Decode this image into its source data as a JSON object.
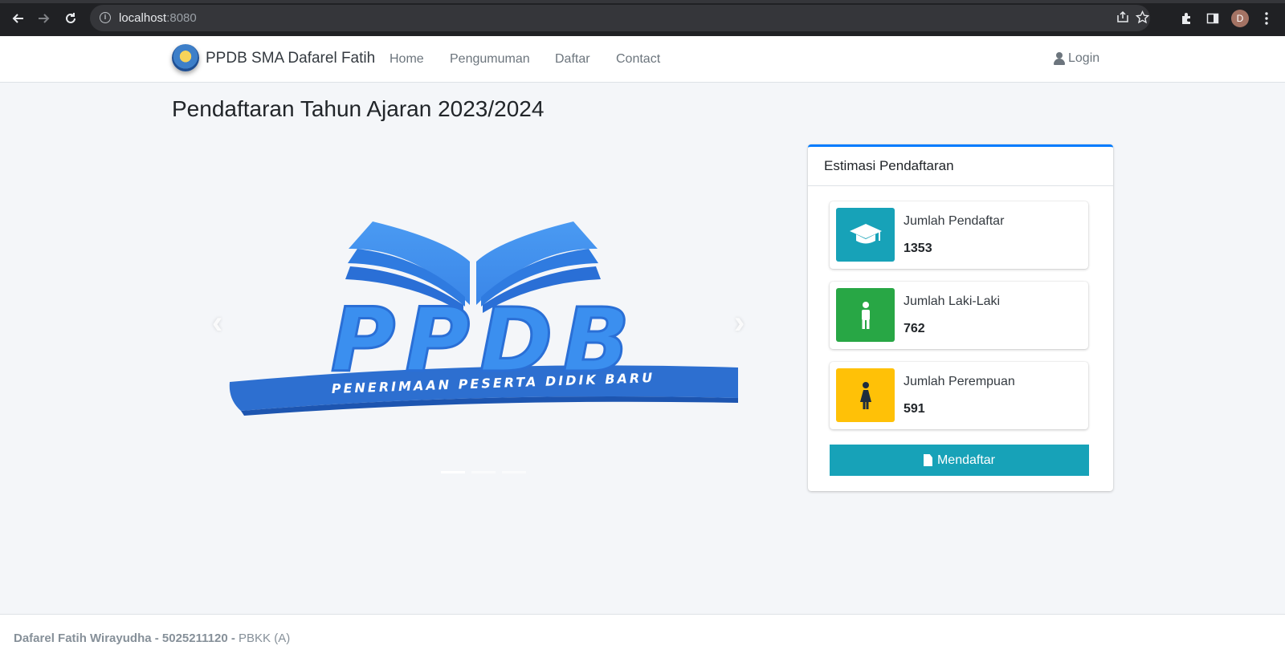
{
  "browser": {
    "url_host": "localhost",
    "url_port": ":8080",
    "profile_initial": "D"
  },
  "navbar": {
    "brand": "PPDB SMA Dafarel Fatih",
    "links": [
      "Home",
      "Pengumuman",
      "Daftar",
      "Contact"
    ],
    "login_label": "Login"
  },
  "page": {
    "title": "Pendaftaran Tahun Ajaran 2023/2024"
  },
  "carousel": {
    "logo_main": "PPDB",
    "logo_sub": "PENERIMAAN PESERTA DIDIK BARU",
    "prev_icon": "‹",
    "next_icon": "›",
    "slides": 3,
    "active_slide": 1
  },
  "card": {
    "title": "Estimasi Pendaftaran",
    "boxes": [
      {
        "label": "Jumlah Pendaftar",
        "value": "1353",
        "icon": "graduation-cap-icon",
        "color": "#17a2b8"
      },
      {
        "label": "Jumlah Laki-Laki",
        "value": "762",
        "icon": "male-icon",
        "color": "#28a745"
      },
      {
        "label": "Jumlah Perempuan",
        "value": "591",
        "icon": "female-icon",
        "color": "#ffc107"
      }
    ],
    "button_label": "Mendaftar"
  },
  "footer": {
    "author": "Dafarel Fatih Wirayudha - 5025211120 -",
    "course": "PBKK (A)"
  },
  "colors": {
    "primary": "#007bff",
    "info": "#17a2b8",
    "success": "#28a745",
    "warning": "#ffc107",
    "logo_blue": "#3b8fef"
  }
}
